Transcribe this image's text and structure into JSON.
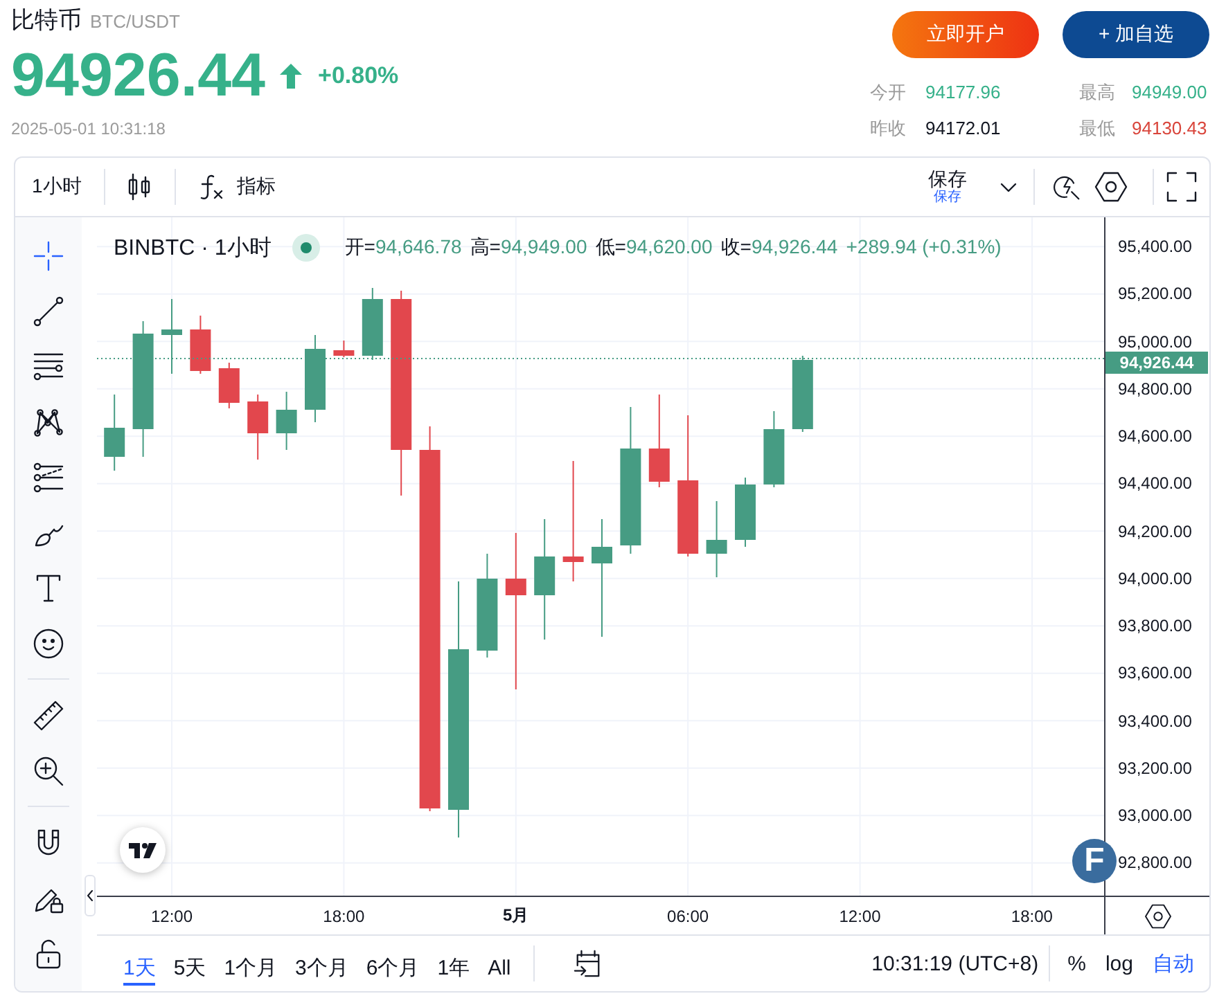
{
  "header": {
    "name": "比特币",
    "symbol": "BTC/USDT",
    "price": "94926.44",
    "rising": true,
    "change": "+0.80%",
    "timestamp": "2025-05-01 10:31:18"
  },
  "actions": [
    {
      "label": "立即开户",
      "kind": "primary"
    },
    {
      "label": "+ 加自选",
      "kind": "secondary"
    }
  ],
  "stats": [
    {
      "label": "今开",
      "value": "94177.96",
      "color": "#36b18a"
    },
    {
      "label": "最高",
      "value": "94949.00",
      "color": "#36b18a"
    },
    {
      "label": "昨收",
      "value": "94172.01",
      "color": "#131722"
    },
    {
      "label": "最低",
      "value": "94130.43",
      "color": "#d9453b"
    }
  ],
  "toolbar": {
    "interval": "1小时",
    "indicators": "指标",
    "save": {
      "label": "保存",
      "sublabel": "保存"
    }
  },
  "drawing_tools": [
    [
      {
        "kind": "crosshair",
        "selected": true
      },
      {
        "kind": "trend-line",
        "selected": false
      },
      {
        "kind": "parallel-lines",
        "selected": false
      },
      {
        "kind": "pattern",
        "selected": false
      },
      {
        "kind": "projection",
        "selected": false
      },
      {
        "kind": "brush",
        "selected": false
      },
      {
        "kind": "text",
        "selected": false
      },
      {
        "kind": "emoji",
        "selected": false
      }
    ],
    [
      {
        "kind": "ruler",
        "selected": false
      },
      {
        "kind": "zoom-in",
        "selected": false
      }
    ],
    [
      {
        "kind": "magnet",
        "selected": false
      },
      {
        "kind": "pencil-lock",
        "selected": false
      },
      {
        "kind": "lock",
        "selected": false
      }
    ]
  ],
  "legend": {
    "title": "BINBTC · 1小时",
    "ohlc": [
      {
        "label": "开=",
        "value": "94,646.78"
      },
      {
        "label": "高=",
        "value": "94,949.00"
      },
      {
        "label": "低=",
        "value": "94,620.00"
      },
      {
        "label": "收=",
        "value": "94,926.44"
      }
    ],
    "change": "+289.94 (+0.31%)"
  },
  "price_axis": {
    "ticks": [
      "95,400.00",
      "95,200.00",
      "95,000.00",
      "94,800.00",
      "94,600.00",
      "94,400.00",
      "94,200.00",
      "94,000.00",
      "93,800.00",
      "93,600.00",
      "93,400.00",
      "93,200.00",
      "93,000.00",
      "92,800.00"
    ],
    "last_price": "94,926.44"
  },
  "badge": "F",
  "time_axis": {
    "ticks": [
      {
        "label": "12:00",
        "kind": "time"
      },
      {
        "label": "18:00",
        "kind": "time"
      },
      {
        "label": "5月",
        "kind": "date"
      },
      {
        "label": "06:00",
        "kind": "time"
      },
      {
        "label": "12:00",
        "kind": "time"
      },
      {
        "label": "18:00",
        "kind": "time"
      }
    ]
  },
  "ranges": [
    {
      "label": "1天",
      "selected": true
    },
    {
      "label": "5天",
      "selected": false
    },
    {
      "label": "1个月",
      "selected": false
    },
    {
      "label": "3个月",
      "selected": false
    },
    {
      "label": "6个月",
      "selected": false
    },
    {
      "label": "1年",
      "selected": false
    },
    {
      "label": "All",
      "selected": false
    }
  ],
  "clock": "10:31:19 (UTC+8)",
  "scale_options": [
    {
      "label": "%",
      "selected": false
    },
    {
      "label": "log",
      "selected": false
    },
    {
      "label": "自动",
      "selected": true
    }
  ]
}
